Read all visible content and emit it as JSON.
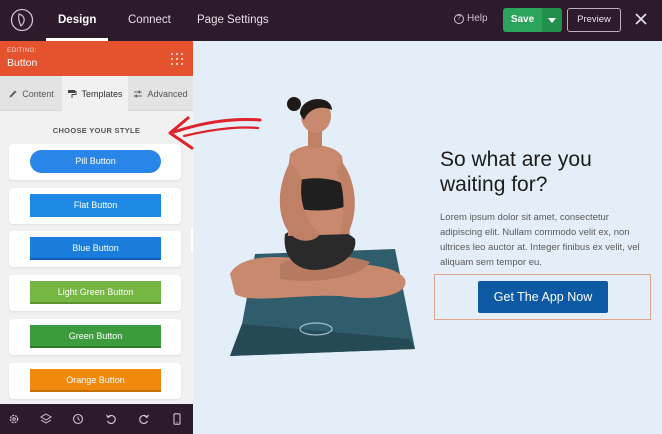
{
  "topbar": {
    "tabs": [
      {
        "label": "Design",
        "active": true
      },
      {
        "label": "Connect",
        "active": false
      },
      {
        "label": "Page Settings",
        "active": false
      }
    ],
    "help_label": "Help",
    "save_label": "Save",
    "preview_label": "Preview",
    "colors": {
      "bar": "#2d1a2b",
      "save": "#2aa55b"
    }
  },
  "sidebar": {
    "editing_label": "EDITING:",
    "editing_title": "Button",
    "tabs": [
      {
        "label": "Content",
        "icon": "pencil-icon"
      },
      {
        "label": "Templates",
        "icon": "paint-roller-icon",
        "active": true
      },
      {
        "label": "Advanced",
        "icon": "sliders-icon"
      }
    ],
    "section_title": "CHOOSE YOUR STYLE",
    "styles": [
      {
        "label": "Pill Button",
        "color": "#2a85e8"
      },
      {
        "label": "Flat Button",
        "color": "#1e88e5"
      },
      {
        "label": "Blue Button",
        "color": "#1a7ddc"
      },
      {
        "label": "Light Green Button",
        "color": "#76b743"
      },
      {
        "label": "Green Button",
        "color": "#3c9b3c"
      },
      {
        "label": "Orange Button",
        "color": "#ef8a0f"
      }
    ],
    "bottom_icons": [
      "gear-icon",
      "layers-icon",
      "history-icon",
      "undo-icon",
      "redo-icon",
      "mobile-icon"
    ]
  },
  "canvas": {
    "headline": "So what are you waiting for?",
    "paragraph": "Lorem ipsum dolor sit amet, consectetur adipiscing elit. Nullam commodo velit ex, non ultrices leo auctor at. Integer finibus ex velit, vel aliquam sem tempor eu.",
    "cta_label": "Get The App Now",
    "colors": {
      "cta": "#0d59a3",
      "annotation": "#e0222c"
    }
  }
}
